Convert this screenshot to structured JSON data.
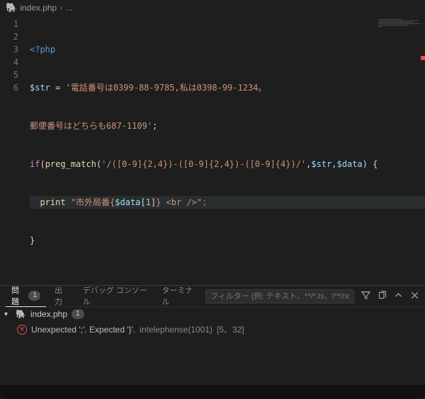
{
  "breadcrumb": {
    "file_name": "index.php",
    "ellipsis": "..."
  },
  "code": {
    "l1": "<?php",
    "l2_var": "$str",
    "l2_eq": " = ",
    "l2_str": "'電話番号は0399-88-9785,私は0398-99-1234。",
    "l3_str": "郵便番号はどちらも687-1109'",
    "l3_semi": ";",
    "l4_if": "if",
    "l4_open": "(",
    "l4_fn": "preg_match",
    "l4_args_open": "(",
    "l4_pattern": "'/([0-9]{2,4})-([0-9]{2,4})-([0-9]{4})/'",
    "l4_comma1": ",",
    "l4_arg2": "$str",
    "l4_comma2": ",",
    "l4_arg3": "$data",
    "l4_close": ")",
    "l4_brace": " {",
    "l5_indent": "  ",
    "l5_print": "print",
    "l5_sp": " ",
    "l5_str_a": "\"市外局番{",
    "l5_var": "$data",
    "l5_idx_open": "[",
    "l5_idx": "1",
    "l5_idx_close": "]",
    "l5_str_b": "} <br />\"",
    "l5_semi": ";",
    "l6": "}"
  },
  "line_numbers": [
    "1",
    "2",
    "3",
    "4",
    "5",
    "6"
  ],
  "panel": {
    "tabs": {
      "problems": "問題",
      "problems_count": "1",
      "output": "出力",
      "debug": "デバッグ コンソール",
      "terminal": "ターミナル"
    },
    "filter_placeholder": "フィルター (例: テキスト、**/*.ts、!**/node_m...",
    "problem_file": "index.php",
    "problem_file_count": "1",
    "problem_msg": "Unexpected ';'. Expected '}'.",
    "problem_source": "intelephense(1001)",
    "problem_loc": "[5、32]"
  }
}
